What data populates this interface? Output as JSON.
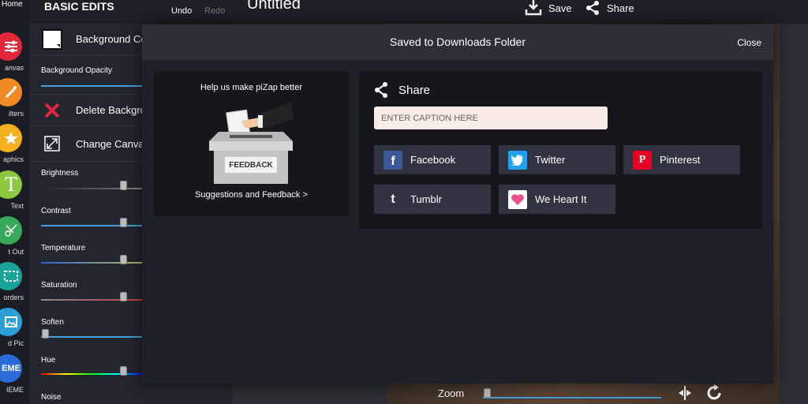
{
  "rail": {
    "home_label": "Home",
    "tools": [
      {
        "label": "anvas",
        "color": "#e0283a"
      },
      {
        "label": "ilters",
        "color": "#f08a22"
      },
      {
        "label": "aphics",
        "color": "#f5b020"
      },
      {
        "label": "Text",
        "color": "#8dc63f"
      },
      {
        "label": "t Out",
        "color": "#38a85a"
      },
      {
        "label": "orders",
        "color": "#1aa39a"
      },
      {
        "label": "d Pic",
        "color": "#2a9fd8"
      },
      {
        "label": "IEME",
        "color": "#2a6bd8"
      }
    ],
    "tool_glyphs": {
      "text": "T",
      "meme": "EME"
    }
  },
  "panel": {
    "title": "BASIC EDITS",
    "undo": "Undo",
    "redo": "Redo",
    "background_color": "Background Co",
    "background_opacity": "Background Opacity",
    "delete_background": "Delete Backgro",
    "change_canvas": "Change Canva",
    "sliders": [
      {
        "label": "Brightness",
        "value": 0.65
      },
      {
        "label": "Contrast",
        "value": 0.65
      },
      {
        "label": "Temperature",
        "value": 0.65
      },
      {
        "label": "Saturation",
        "value": 0.65
      },
      {
        "label": "Soften",
        "value": 0.0
      },
      {
        "label": "Hue",
        "value": 0.65
      },
      {
        "label": "Noise",
        "value": 0.0
      }
    ]
  },
  "topbar": {
    "title": "Untitled",
    "save": "Save",
    "share": "Share"
  },
  "zoom": {
    "label": "Zoom",
    "value": 0.0
  },
  "modal": {
    "title": "Saved to Downloads Folder",
    "close": "Close",
    "feedback": {
      "title": "Help us make piZap better",
      "ballot_label": "FEEDBACK",
      "link": "Suggestions and Feedback >"
    },
    "share": {
      "heading": "Share",
      "caption_placeholder": "ENTER CAPTION HERE",
      "buttons": [
        {
          "label": "Facebook",
          "color": "#3b5998",
          "glyph": "f"
        },
        {
          "label": "Twitter",
          "color": "#1da1f2",
          "glyph": ""
        },
        {
          "label": "Pinterest",
          "color": "#e60023",
          "glyph": "P"
        },
        {
          "label": "Tumblr",
          "color": "#2f3440",
          "glyph": "t"
        },
        {
          "label": "We Heart It",
          "color": "#ffffff",
          "glyph": ""
        }
      ]
    }
  },
  "colors": {
    "accent": "#4a9bd6",
    "modal_bg": "#1d2027"
  }
}
